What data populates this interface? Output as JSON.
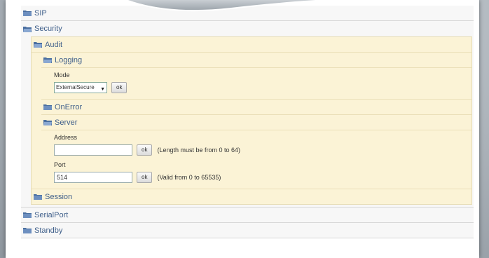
{
  "tree": {
    "sip": "SIP",
    "security": "Security",
    "audit": "Audit",
    "logging": "Logging",
    "mode_label": "Mode",
    "mode_value": "ExternalSecure",
    "onerror": "OnError",
    "server": "Server",
    "address_label": "Address",
    "address_value": "",
    "address_hint": "(Length must be from 0 to 64)",
    "port_label": "Port",
    "port_value": "514",
    "port_hint": "(Valid from 0 to 65535)",
    "session": "Session",
    "serialport": "SerialPort",
    "standby": "Standby",
    "ok_label": "ok"
  },
  "icons": {
    "folder": "folder-icon",
    "dropdown": "chevron-down-icon"
  },
  "colors": {
    "label_blue": "#3f5f8a",
    "audit_bg": "#fbf3d6"
  }
}
